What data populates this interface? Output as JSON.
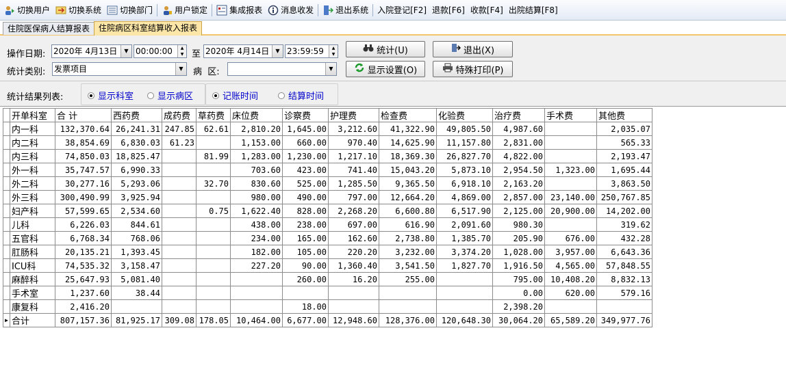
{
  "toolbar": {
    "items": [
      {
        "label": "切换用户",
        "icon": "switch-user-icon"
      },
      {
        "label": "切换系统",
        "icon": "switch-system-icon"
      },
      {
        "label": "切换部门",
        "icon": "switch-department-icon"
      },
      {
        "label": "用户锁定",
        "icon": "user-lock-icon"
      },
      {
        "label": "集成报表",
        "icon": "report-icon"
      },
      {
        "label": "消息收发",
        "icon": "message-icon"
      },
      {
        "label": "退出系统",
        "icon": "exit-system-icon"
      },
      {
        "label": "入院登记[F2]"
      },
      {
        "label": "退款[F6]"
      },
      {
        "label": "收款[F4]"
      },
      {
        "label": "出院结算[F8]"
      }
    ]
  },
  "tabs": [
    {
      "label": "住院医保病人结算报表",
      "active": false
    },
    {
      "label": "住院病区科室结算收入报表",
      "active": true
    }
  ],
  "filters": {
    "date_label": "操作日期:",
    "start_date": "2020年 4月13日",
    "start_time": "00:00:00",
    "to_label": "至",
    "end_date": "2020年 4月14日",
    "end_time": "23:59:59",
    "category_label": "统计类别:",
    "category_value": "发票项目",
    "ward_label": "病  区:",
    "ward_value": ""
  },
  "buttons": {
    "stats": "统计(U)",
    "exit": "退出(X)",
    "display_settings": "显示设置(O)",
    "special_print": "特殊打印(P)"
  },
  "result_bar": {
    "label": "统计结果列表:",
    "show_dept": "显示科室",
    "show_ward": "显示病区",
    "post_time": "记账时间",
    "settle_time": "结算时间",
    "selected_display": "显示科室",
    "selected_time": "记账时间"
  },
  "table": {
    "columns": [
      "开单科室",
      "合 计",
      "西药费",
      "成药费",
      "草药费",
      "床位费",
      "诊察费",
      "护理费",
      "检查费",
      "化验费",
      "治疗费",
      "手术费",
      "其他费"
    ],
    "rows": [
      [
        "内一科",
        "132,370.64",
        "26,241.31",
        "247.85",
        "62.61",
        "2,810.20",
        "1,645.00",
        "3,212.60",
        "41,322.90",
        "49,805.50",
        "4,987.60",
        "",
        "2,035.07"
      ],
      [
        "内二科",
        "38,854.69",
        "6,830.03",
        "61.23",
        "",
        "1,153.00",
        "660.00",
        "970.40",
        "14,625.90",
        "11,157.80",
        "2,831.00",
        "",
        "565.33"
      ],
      [
        "内三科",
        "74,850.03",
        "18,825.47",
        "",
        "81.99",
        "1,283.00",
        "1,230.00",
        "1,217.10",
        "18,369.30",
        "26,827.70",
        "4,822.00",
        "",
        "2,193.47"
      ],
      [
        "外一科",
        "35,747.57",
        "6,990.33",
        "",
        "",
        "703.60",
        "423.00",
        "741.40",
        "15,043.20",
        "5,873.10",
        "2,954.50",
        "1,323.00",
        "1,695.44"
      ],
      [
        "外二科",
        "30,277.16",
        "5,293.06",
        "",
        "32.70",
        "830.60",
        "525.00",
        "1,285.50",
        "9,365.50",
        "6,918.10",
        "2,163.20",
        "",
        "3,863.50"
      ],
      [
        "外三科",
        "300,490.99",
        "3,925.94",
        "",
        "",
        "980.00",
        "490.00",
        "797.00",
        "12,664.20",
        "4,869.00",
        "2,857.00",
        "23,140.00",
        "250,767.85"
      ],
      [
        "妇产科",
        "57,599.65",
        "2,534.60",
        "",
        "0.75",
        "1,622.40",
        "828.00",
        "2,268.20",
        "6,600.80",
        "6,517.90",
        "2,125.00",
        "20,900.00",
        "14,202.00"
      ],
      [
        "儿科",
        "6,226.03",
        "844.61",
        "",
        "",
        "438.00",
        "238.00",
        "697.00",
        "616.90",
        "2,091.60",
        "980.30",
        "",
        "319.62"
      ],
      [
        "五官科",
        "6,768.34",
        "768.06",
        "",
        "",
        "234.00",
        "165.00",
        "162.60",
        "2,738.80",
        "1,385.70",
        "205.90",
        "676.00",
        "432.28"
      ],
      [
        "肛肠科",
        "20,135.21",
        "1,393.45",
        "",
        "",
        "182.00",
        "105.00",
        "220.20",
        "3,232.00",
        "3,374.20",
        "1,028.00",
        "3,957.00",
        "6,643.36"
      ],
      [
        "ICU科",
        "74,535.32",
        "3,158.47",
        "",
        "",
        "227.20",
        "90.00",
        "1,360.40",
        "3,541.50",
        "1,827.70",
        "1,916.50",
        "4,565.00",
        "57,848.55"
      ],
      [
        "麻醉科",
        "25,647.93",
        "5,081.40",
        "",
        "",
        "",
        "260.00",
        "16.20",
        "255.00",
        "",
        "795.00",
        "10,408.20",
        "8,832.13"
      ],
      [
        "手术室",
        "1,237.60",
        "38.44",
        "",
        "",
        "",
        "",
        "",
        "",
        "",
        "0.00",
        "620.00",
        "579.16"
      ],
      [
        "康复科",
        "2,416.20",
        "",
        "",
        "",
        "",
        "18.00",
        "",
        "",
        "",
        "2,398.20",
        "",
        ""
      ],
      [
        "合计",
        "807,157.36",
        "81,925.17",
        "309.08",
        "178.05",
        "10,464.00",
        "6,677.00",
        "12,948.60",
        "128,376.00",
        "120,648.30",
        "30,064.20",
        "65,589.20",
        "349,977.76"
      ]
    ]
  },
  "colors": {
    "toolbar_top": "#fbfcfe",
    "toolbar_bottom": "#e4ebf5",
    "active_tab": "#fce7a8",
    "radio_text": "#0000cc",
    "panel_bg": "#f0f0f0"
  }
}
